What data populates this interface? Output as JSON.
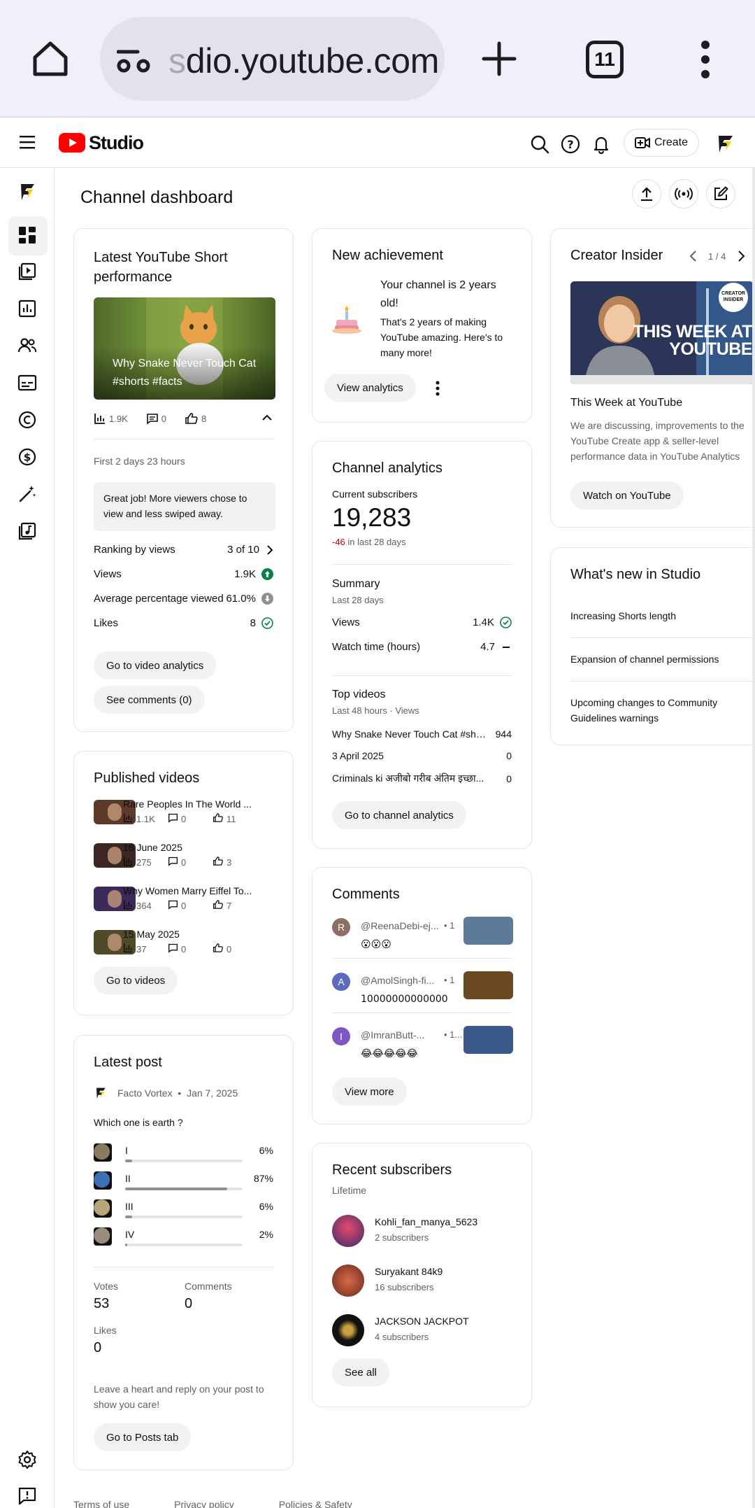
{
  "browser": {
    "url_prefix": "s",
    "url": "dio.youtube.com",
    "tab_count": "11"
  },
  "header": {
    "logo_text": "Studio",
    "create_label": "Create"
  },
  "dashboard": {
    "title": "Channel dashboard"
  },
  "short_card": {
    "title": "Latest YouTube Short performance",
    "video_title": "Why Snake Never Touch Cat #shorts #facts",
    "views": "1.9K",
    "comments": "0",
    "likes": "8",
    "period": "First 2 days 23 hours",
    "message": "Great job! More viewers chose to view and less swiped away.",
    "ranking_label": "Ranking by views",
    "ranking_value": "3 of 10",
    "views_label": "Views",
    "views_value": "1.9K",
    "avg_label": "Average percentage viewed",
    "avg_value": "61.0%",
    "likes_label": "Likes",
    "likes_value": "8",
    "btn_analytics": "Go to video analytics",
    "btn_comments": "See comments (0)"
  },
  "published": {
    "title": "Published videos",
    "videos": [
      {
        "title": "Rare Peoples In The World ...",
        "views": "1.1K",
        "comments": "0",
        "likes": "11"
      },
      {
        "title": "16 June 2025",
        "views": "275",
        "comments": "0",
        "likes": "3"
      },
      {
        "title": "Why Women Marry Eiffel To...",
        "views": "364",
        "comments": "0",
        "likes": "7"
      },
      {
        "title": "15 May 2025",
        "views": "37",
        "comments": "0",
        "likes": "0"
      }
    ],
    "btn": "Go to videos"
  },
  "latest_post": {
    "title": "Latest post",
    "channel": "Facto Vortex",
    "date": "Jan 7, 2025",
    "question": "Which one is earth ?",
    "options": [
      {
        "label": "I",
        "pct": "6%",
        "value": 6
      },
      {
        "label": "II",
        "pct": "87%",
        "value": 87
      },
      {
        "label": "III",
        "pct": "6%",
        "value": 6
      },
      {
        "label": "IV",
        "pct": "2%",
        "value": 2
      }
    ],
    "votes_label": "Votes",
    "votes": "53",
    "comments_label": "Comments",
    "comments": "0",
    "likes_label": "Likes",
    "likes": "0",
    "hint": "Leave a heart and reply on your post to show you care!",
    "btn": "Go to Posts tab"
  },
  "achievement": {
    "title": "New achievement",
    "headline": "Your channel is 2 years old!",
    "text": "That's 2 years of making YouTube amazing. Here's to many more!",
    "btn": "View analytics"
  },
  "analytics": {
    "title": "Channel analytics",
    "subs_label": "Current subscribers",
    "subs": "19,283",
    "change": "-46",
    "change_suffix": " in last 28 days",
    "summary": "Summary",
    "summary_period": "Last 28 days",
    "views_label": "Views",
    "views_value": "1.4K",
    "watch_label": "Watch time (hours)",
    "watch_value": "4.7",
    "top_title": "Top videos",
    "top_period": "Last 48 hours · Views",
    "top": [
      {
        "title": "Why Snake Never Touch Cat #sho...",
        "value": "944"
      },
      {
        "title": "3 April 2025",
        "value": "0"
      },
      {
        "title": "Criminals ki अजीबो गरीब अंतिम इच्छा...",
        "value": "0"
      }
    ],
    "btn": "Go to channel analytics"
  },
  "comments": {
    "title": "Comments",
    "items": [
      {
        "initial": "R",
        "user": "@ReenaDebi-ej...",
        "meta": "• 1",
        "text": "😮😮😮",
        "color": "#8d6e63"
      },
      {
        "initial": "A",
        "user": "@AmolSingh-fi...",
        "meta": "• 1",
        "text": "10000000000000",
        "color": "#5c6bc0"
      },
      {
        "initial": "I",
        "user": "@ImranButt-...",
        "meta": "• 1...",
        "text": "😂😂😂😂😂",
        "color": "#7e57c2"
      }
    ],
    "btn": "View more"
  },
  "subscribers": {
    "title": "Recent subscribers",
    "period": "Lifetime",
    "items": [
      {
        "name": "Kohli_fan_manya_5623",
        "subs": "2 subscribers"
      },
      {
        "name": "Suryakant 84k9",
        "subs": "16 subscribers"
      },
      {
        "name": "JACKSON JACKPOT",
        "subs": "4 subscribers"
      }
    ],
    "btn": "See all"
  },
  "insider": {
    "title": "Creator Insider",
    "pager": "1 / 4",
    "thumb_text": "THIS WEEK AT YOUTUBE",
    "badge": "CREATOR INSIDER",
    "video_title": "This Week at YouTube",
    "desc": "We are discussing, improvements to the YouTube Create app & seller-level performance data in YouTube Analytics",
    "btn": "Watch on YouTube"
  },
  "whats_new": {
    "title": "What's new in Studio",
    "items": [
      "Increasing Shorts length",
      "Expansion of channel permissions",
      "Upcoming changes to Community Guidelines warnings"
    ]
  },
  "footer": {
    "links": [
      "Terms of use",
      "Privacy policy",
      "Policies & Safety"
    ]
  }
}
